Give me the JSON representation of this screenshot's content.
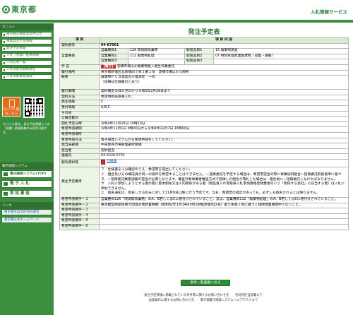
{
  "header": {
    "logo_text": "東京都",
    "service_title": "入札情報サービス"
  },
  "sidebar": {
    "menu_heading": "メニュー",
    "items": [
      {
        "label": "東京都公報発注案件公告"
      },
      {
        "label": "事業発注予定情報"
      },
      {
        "label": "発注予定情報"
      },
      {
        "label": "入札（見積）結果情報"
      },
      {
        "label": "入札結果一覧"
      },
      {
        "label": "入札参加有資格者名"
      },
      {
        "label": "入札参加資格情報"
      }
    ],
    "mobile_label": "モバイル版",
    "mobile_sub": "はこちら",
    "mobile_text": "モバイル版は、発注予定情報と入札（見積）結果情報のみ利用可能です。",
    "system_heading": "電子調達システム",
    "big_buttons": [
      {
        "label": "電子調達システム(TOP)"
      },
      {
        "label": "電 子 入 札"
      },
      {
        "label": "資 格 審 査"
      }
    ],
    "links_heading": "リンク",
    "links": [
      {
        "label": "東京電子自治体共同運営"
      },
      {
        "label": "東京都公式ホームページ"
      }
    ]
  },
  "main": {
    "page_title": "発注予定表",
    "table_headers": {
      "item": "項 目",
      "content": "項 目 内 容"
    },
    "contract_no_label": "契約番号",
    "contract_no": "04-87061",
    "biz_type_label": "営業種目",
    "biz_rows": [
      {
        "sub1": "営業種目1",
        "code1": "126 環境関係業務",
        "sub2": "取扱品目1",
        "code2": "16 廃棄物調査"
      },
      {
        "sub1": "営業種目2",
        "code1": "112 廃棄物処理",
        "sub2": "取扱品目2",
        "code2": "07 特別管理産業廃棄物（収集・運搬）"
      },
      {
        "sub1": "営業種目3",
        "code1": "",
        "sub2": "取扱品目3",
        "code2": ""
      }
    ],
    "subject_label": "件 名",
    "subject_tag": "【電子】",
    "subject_text": "淀橋市場ほか廃棄物搬入発生作業委託",
    "location_label": "履行場所",
    "location_text": "東京都新宿区北新宿四丁目２番１号　淀橋市場ほか５箇所",
    "overview_label": "概要",
    "overview_lines": [
      "廃棄物ＰＣＢ濃度及び量測定　一式",
      "（詳細は仕様書のとおり）"
    ],
    "period_label": "履行期間",
    "period_text": "契約確定の日の翌日から令和5年2月28日まで",
    "contract_method_label": "契約方法",
    "contract_method_text": "希望制指名競争入札",
    "order_class_label": "発注等級",
    "order_class_text": "C",
    "accept_class_label": "受付等級",
    "accept_class_text": "A,B,C",
    "other_label": "その他",
    "other_text": "",
    "public_date_label": "公報登載日",
    "public_date_text": "",
    "publication_label": "開札予定日時",
    "publication_text": "令和4年11月16日 10時10分",
    "apply_period_label": "希望申請期間",
    "apply_period_text": "令和4年11月1日 9時00分から令和4年11月7日 16時00分",
    "apply_place_label": "希望申請場所",
    "apply_place_text": "",
    "apply_method_label": "希望申請方法",
    "apply_method_text": "電子調達システムから希望申請をしてください。",
    "dept_label": "担当局部課",
    "dept_text": "中央卸売市場管理部財務課",
    "person_label": "担当者",
    "person_text": "契約担当",
    "contact_label": "連絡先",
    "contact_text": "03-5320-5741",
    "spec_label": "配布資料等",
    "spec_link": "仕様書",
    "remarks_label": "発注予定備考",
    "remarks_lines": [
      "ア　仕様書を十分確認のうえ、希望票を提出してください。",
      "イ　組合及びその構成員が同一の案件を希望することはできません。一括再委託を予定する場合は、希望票提出の際に事業協同組合一括再委託取扱基準に基づき、一括再委託業者調書の提出が必要となります。審査対象事業者審査方式で登録した組合が落札した場合は、組合員に一括再委託しなければなりません。",
      "ウ　入札に参加しようとする者の開に資本関係又は人的関係がある者（物品買入れ等競争入札参加資格登録業者のいう「関係する会社」に該当する者）は入札に参加できません。",
      "エ　指名通知は、指名した方のみに対して11月9日以降に行う予定です。なお、希望票の提出があっても、必ずしも指名されるとは限りません。"
    ],
    "req_rows": [
      {
        "label": "希望申請要件－１",
        "text": "営業種目126「環境関係業務」のA、B若しくはCに格付けされていること。又は、営業種目112「廃棄物処理」のA、B若しくはCに格付けされていること。"
      },
      {
        "label": "希望申請要件－２",
        "text": "東京都契約関係暴力団等対策措置要綱（昭和62年1月14日付61財経庶第922号）第５条第１項に基づく排除措置期間中でないこと。"
      },
      {
        "label": "希望申請要件－３",
        "text": ""
      },
      {
        "label": "希望申請要件－４",
        "text": ""
      },
      {
        "label": "希望申請要件－５",
        "text": ""
      },
      {
        "label": "希望申請要件－６",
        "text": ""
      }
    ],
    "back_button": "案件一覧画面へ戻る"
  },
  "footer": {
    "line1": "発注予定情報に掲載されている条件等に関するお問い合わせ先　　各局所担当部署まで",
    "line2": "画面操作に関するお問い合わせ先　　東京都電子調達システムヘルプデスクまで"
  },
  "colors": {
    "brand_green": "#2e7d32",
    "sidebar_green": "#3c8f3f",
    "mobile_orange": "#e86b1a",
    "tag_red": "#d62828"
  },
  "icons": [
    "tokyo-logo-icon",
    "phone-icon",
    "qr-code-icon",
    "pdf-icon"
  ]
}
